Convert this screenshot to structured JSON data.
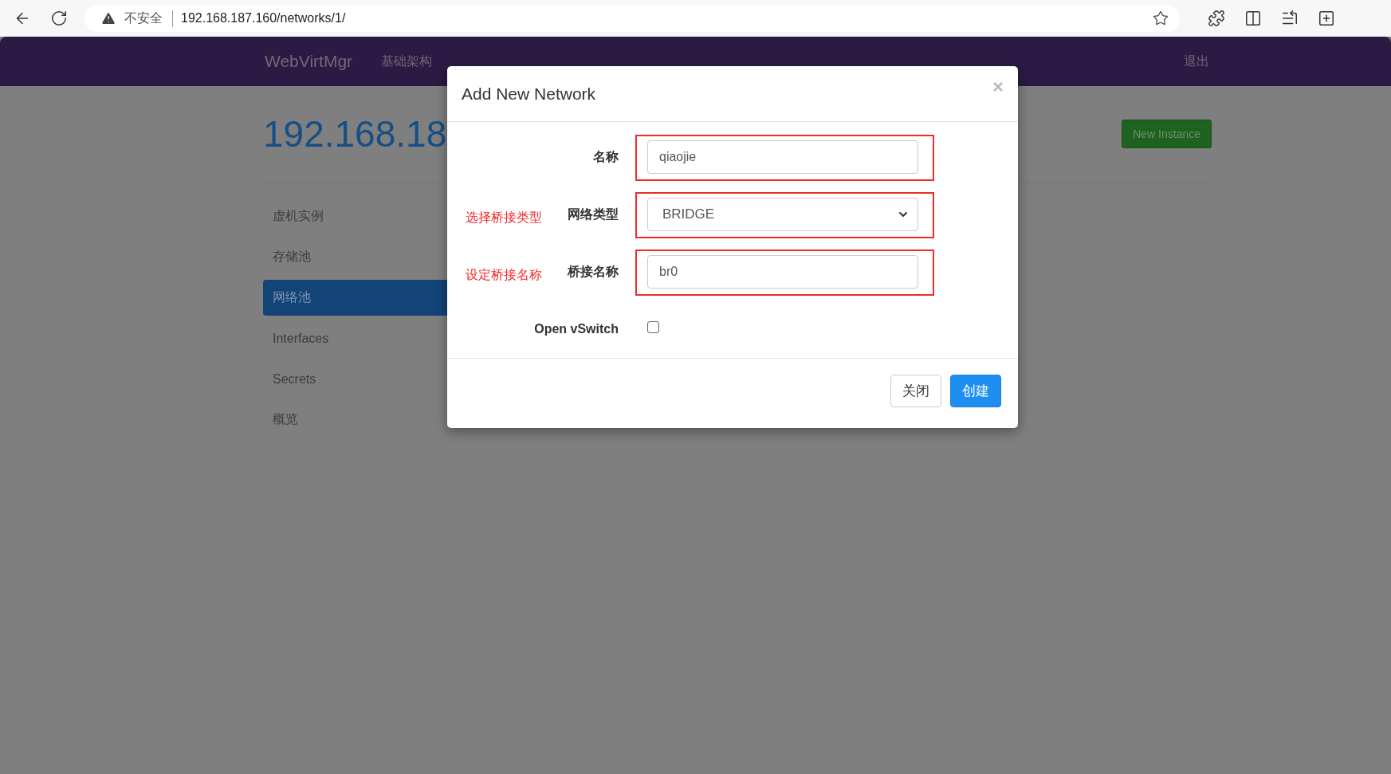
{
  "browser": {
    "security_label": "不安全",
    "url": "192.168.187.160/networks/1/"
  },
  "navbar": {
    "brand": "WebVirtMgr",
    "links": [
      "基础架构"
    ],
    "logout": "退出"
  },
  "page": {
    "title": "192.168.18",
    "new_instance_button": "New Instance",
    "sidebar": [
      {
        "label": "虚机实例",
        "selected": false
      },
      {
        "label": "存储池",
        "selected": false
      },
      {
        "label": "网络池",
        "selected": true
      },
      {
        "label": "Interfaces",
        "selected": false
      },
      {
        "label": "Secrets",
        "selected": false
      },
      {
        "label": "概览",
        "selected": false
      }
    ]
  },
  "modal": {
    "title": "Add New Network",
    "close": "×",
    "fields": [
      {
        "kind": "text",
        "label": "名称",
        "value": "qiaojie",
        "highlighted": true
      },
      {
        "kind": "select",
        "label": "网络类型",
        "value": "BRIDGE",
        "highlighted": true,
        "annotation": "选择桥接类型"
      },
      {
        "kind": "text",
        "label": "桥接名称",
        "value": "br0",
        "highlighted": true,
        "annotation": "设定桥接名称"
      },
      {
        "kind": "checkbox",
        "label": "Open vSwitch",
        "checked": false
      }
    ],
    "buttons": [
      {
        "label": "关闭",
        "kind": "default"
      },
      {
        "label": "创建",
        "kind": "primary"
      }
    ]
  }
}
